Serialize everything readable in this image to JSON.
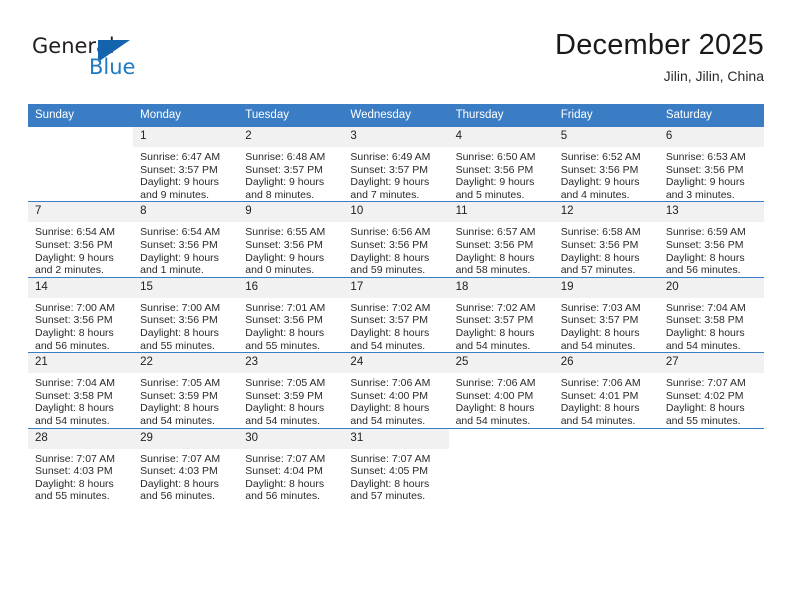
{
  "brand": {
    "name_top": "General",
    "name_bottom": "Blue",
    "triangle_color": "#1364ad",
    "blue_color": "#1f7bc1"
  },
  "header": {
    "title": "December 2025",
    "location": "Jilin, Jilin, China"
  },
  "theme": {
    "header_bg": "#3b7dc4",
    "header_text": "#ffffff",
    "daynum_bg": "#f1f1f1",
    "row_rule": "#3b7dc4"
  },
  "weekdays": [
    "Sunday",
    "Monday",
    "Tuesday",
    "Wednesday",
    "Thursday",
    "Friday",
    "Saturday"
  ],
  "weeks": [
    [
      {
        "day": "",
        "sunrise": "",
        "sunset": "",
        "daylight1": "",
        "daylight2": "",
        "blank": true
      },
      {
        "day": "1",
        "sunrise": "Sunrise: 6:47 AM",
        "sunset": "Sunset: 3:57 PM",
        "daylight1": "Daylight: 9 hours",
        "daylight2": "and 9 minutes."
      },
      {
        "day": "2",
        "sunrise": "Sunrise: 6:48 AM",
        "sunset": "Sunset: 3:57 PM",
        "daylight1": "Daylight: 9 hours",
        "daylight2": "and 8 minutes."
      },
      {
        "day": "3",
        "sunrise": "Sunrise: 6:49 AM",
        "sunset": "Sunset: 3:57 PM",
        "daylight1": "Daylight: 9 hours",
        "daylight2": "and 7 minutes."
      },
      {
        "day": "4",
        "sunrise": "Sunrise: 6:50 AM",
        "sunset": "Sunset: 3:56 PM",
        "daylight1": "Daylight: 9 hours",
        "daylight2": "and 5 minutes."
      },
      {
        "day": "5",
        "sunrise": "Sunrise: 6:52 AM",
        "sunset": "Sunset: 3:56 PM",
        "daylight1": "Daylight: 9 hours",
        "daylight2": "and 4 minutes."
      },
      {
        "day": "6",
        "sunrise": "Sunrise: 6:53 AM",
        "sunset": "Sunset: 3:56 PM",
        "daylight1": "Daylight: 9 hours",
        "daylight2": "and 3 minutes."
      }
    ],
    [
      {
        "day": "7",
        "sunrise": "Sunrise: 6:54 AM",
        "sunset": "Sunset: 3:56 PM",
        "daylight1": "Daylight: 9 hours",
        "daylight2": "and 2 minutes."
      },
      {
        "day": "8",
        "sunrise": "Sunrise: 6:54 AM",
        "sunset": "Sunset: 3:56 PM",
        "daylight1": "Daylight: 9 hours",
        "daylight2": "and 1 minute."
      },
      {
        "day": "9",
        "sunrise": "Sunrise: 6:55 AM",
        "sunset": "Sunset: 3:56 PM",
        "daylight1": "Daylight: 9 hours",
        "daylight2": "and 0 minutes."
      },
      {
        "day": "10",
        "sunrise": "Sunrise: 6:56 AM",
        "sunset": "Sunset: 3:56 PM",
        "daylight1": "Daylight: 8 hours",
        "daylight2": "and 59 minutes."
      },
      {
        "day": "11",
        "sunrise": "Sunrise: 6:57 AM",
        "sunset": "Sunset: 3:56 PM",
        "daylight1": "Daylight: 8 hours",
        "daylight2": "and 58 minutes."
      },
      {
        "day": "12",
        "sunrise": "Sunrise: 6:58 AM",
        "sunset": "Sunset: 3:56 PM",
        "daylight1": "Daylight: 8 hours",
        "daylight2": "and 57 minutes."
      },
      {
        "day": "13",
        "sunrise": "Sunrise: 6:59 AM",
        "sunset": "Sunset: 3:56 PM",
        "daylight1": "Daylight: 8 hours",
        "daylight2": "and 56 minutes."
      }
    ],
    [
      {
        "day": "14",
        "sunrise": "Sunrise: 7:00 AM",
        "sunset": "Sunset: 3:56 PM",
        "daylight1": "Daylight: 8 hours",
        "daylight2": "and 56 minutes."
      },
      {
        "day": "15",
        "sunrise": "Sunrise: 7:00 AM",
        "sunset": "Sunset: 3:56 PM",
        "daylight1": "Daylight: 8 hours",
        "daylight2": "and 55 minutes."
      },
      {
        "day": "16",
        "sunrise": "Sunrise: 7:01 AM",
        "sunset": "Sunset: 3:56 PM",
        "daylight1": "Daylight: 8 hours",
        "daylight2": "and 55 minutes."
      },
      {
        "day": "17",
        "sunrise": "Sunrise: 7:02 AM",
        "sunset": "Sunset: 3:57 PM",
        "daylight1": "Daylight: 8 hours",
        "daylight2": "and 54 minutes."
      },
      {
        "day": "18",
        "sunrise": "Sunrise: 7:02 AM",
        "sunset": "Sunset: 3:57 PM",
        "daylight1": "Daylight: 8 hours",
        "daylight2": "and 54 minutes."
      },
      {
        "day": "19",
        "sunrise": "Sunrise: 7:03 AM",
        "sunset": "Sunset: 3:57 PM",
        "daylight1": "Daylight: 8 hours",
        "daylight2": "and 54 minutes."
      },
      {
        "day": "20",
        "sunrise": "Sunrise: 7:04 AM",
        "sunset": "Sunset: 3:58 PM",
        "daylight1": "Daylight: 8 hours",
        "daylight2": "and 54 minutes."
      }
    ],
    [
      {
        "day": "21",
        "sunrise": "Sunrise: 7:04 AM",
        "sunset": "Sunset: 3:58 PM",
        "daylight1": "Daylight: 8 hours",
        "daylight2": "and 54 minutes."
      },
      {
        "day": "22",
        "sunrise": "Sunrise: 7:05 AM",
        "sunset": "Sunset: 3:59 PM",
        "daylight1": "Daylight: 8 hours",
        "daylight2": "and 54 minutes."
      },
      {
        "day": "23",
        "sunrise": "Sunrise: 7:05 AM",
        "sunset": "Sunset: 3:59 PM",
        "daylight1": "Daylight: 8 hours",
        "daylight2": "and 54 minutes."
      },
      {
        "day": "24",
        "sunrise": "Sunrise: 7:06 AM",
        "sunset": "Sunset: 4:00 PM",
        "daylight1": "Daylight: 8 hours",
        "daylight2": "and 54 minutes."
      },
      {
        "day": "25",
        "sunrise": "Sunrise: 7:06 AM",
        "sunset": "Sunset: 4:00 PM",
        "daylight1": "Daylight: 8 hours",
        "daylight2": "and 54 minutes."
      },
      {
        "day": "26",
        "sunrise": "Sunrise: 7:06 AM",
        "sunset": "Sunset: 4:01 PM",
        "daylight1": "Daylight: 8 hours",
        "daylight2": "and 54 minutes."
      },
      {
        "day": "27",
        "sunrise": "Sunrise: 7:07 AM",
        "sunset": "Sunset: 4:02 PM",
        "daylight1": "Daylight: 8 hours",
        "daylight2": "and 55 minutes."
      }
    ],
    [
      {
        "day": "28",
        "sunrise": "Sunrise: 7:07 AM",
        "sunset": "Sunset: 4:03 PM",
        "daylight1": "Daylight: 8 hours",
        "daylight2": "and 55 minutes."
      },
      {
        "day": "29",
        "sunrise": "Sunrise: 7:07 AM",
        "sunset": "Sunset: 4:03 PM",
        "daylight1": "Daylight: 8 hours",
        "daylight2": "and 56 minutes."
      },
      {
        "day": "30",
        "sunrise": "Sunrise: 7:07 AM",
        "sunset": "Sunset: 4:04 PM",
        "daylight1": "Daylight: 8 hours",
        "daylight2": "and 56 minutes."
      },
      {
        "day": "31",
        "sunrise": "Sunrise: 7:07 AM",
        "sunset": "Sunset: 4:05 PM",
        "daylight1": "Daylight: 8 hours",
        "daylight2": "and 57 minutes."
      },
      {
        "day": "",
        "sunrise": "",
        "sunset": "",
        "daylight1": "",
        "daylight2": "",
        "blank": true
      },
      {
        "day": "",
        "sunrise": "",
        "sunset": "",
        "daylight1": "",
        "daylight2": "",
        "blank": true
      },
      {
        "day": "",
        "sunrise": "",
        "sunset": "",
        "daylight1": "",
        "daylight2": "",
        "blank": true
      }
    ]
  ]
}
